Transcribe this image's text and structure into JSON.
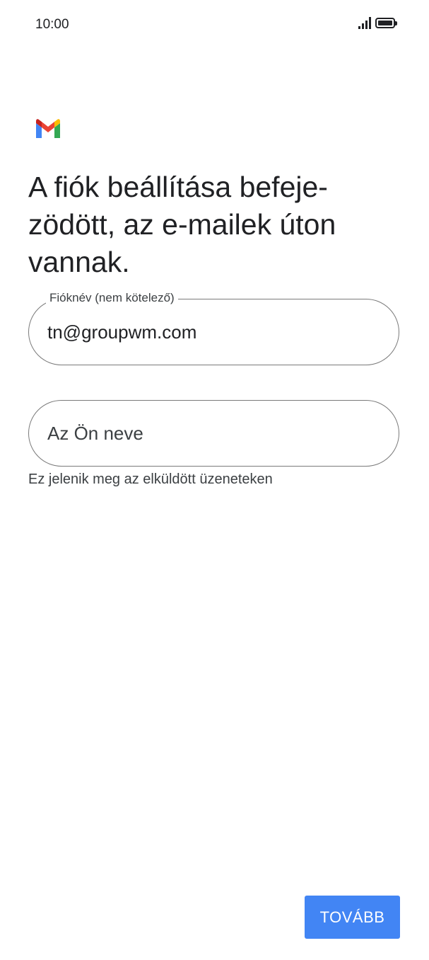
{
  "status_bar": {
    "time": "10:00",
    "signal_icon": "signal-bars-icon",
    "battery_icon": "battery-full-icon"
  },
  "app": {
    "logo": "gmail-logo-icon",
    "colors": {
      "red": "#ea4335",
      "blue": "#4285f4",
      "green": "#34a853",
      "yellow": "#fbbc04"
    }
  },
  "title": "A fiók beállítása befeje-zödött, az e-mailek úton vannak.",
  "account_field": {
    "label": "Fióknév (nem kötelező)",
    "value": "tn@groupwm.com"
  },
  "name_field": {
    "placeholder": "Az Ön neve",
    "helper": "Ez jelenik meg az elküldött üzeneteken"
  },
  "next_button": {
    "label": "TOVÁBB",
    "color": "#4285f4"
  }
}
